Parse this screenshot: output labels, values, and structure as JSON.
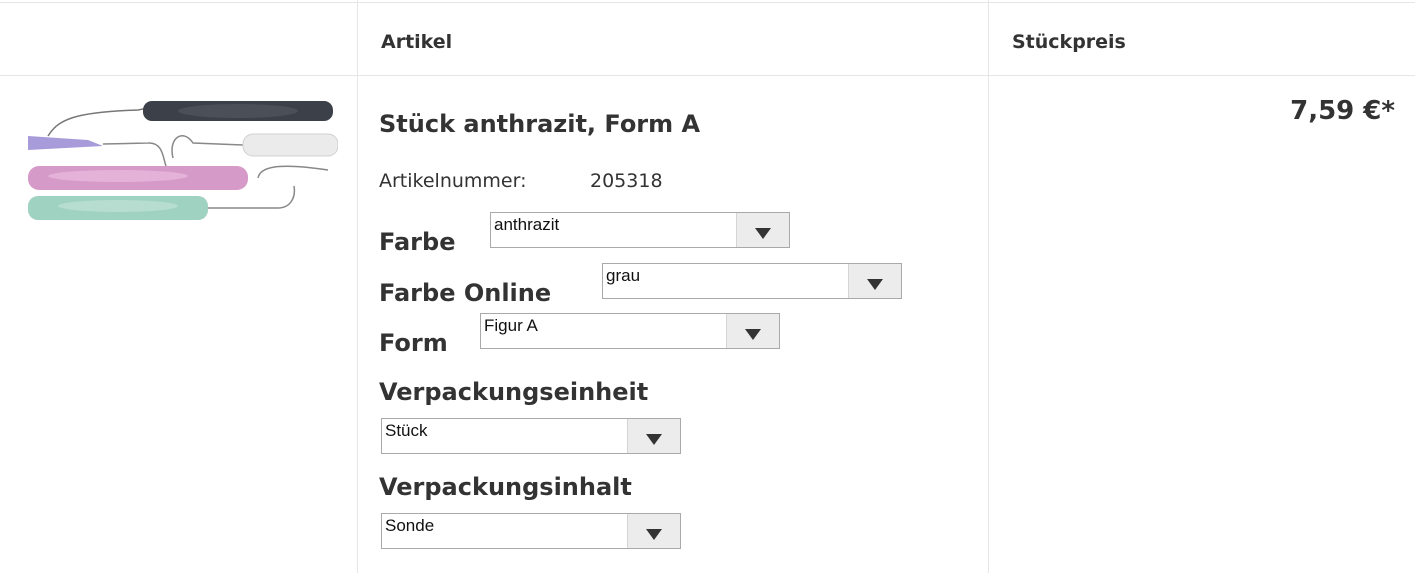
{
  "table": {
    "header_artikel": "Artikel",
    "header_stueckpreis": "Stückpreis"
  },
  "product": {
    "title": "Stück anthrazit, Form A",
    "artikelnummer_label": "Artikelnummer:",
    "artikelnummer_value": "205318",
    "price": "7,59 €*",
    "image_icon": "dental-instruments-image",
    "options": {
      "farbe": {
        "label": "Farbe",
        "selected": "anthrazit"
      },
      "farbe_online": {
        "label": "Farbe Online",
        "selected": "grau"
      },
      "form": {
        "label": "Form",
        "selected": "Figur A"
      },
      "verpackungseinheit": {
        "label": "Verpackungseinheit",
        "selected": "Stück"
      },
      "verpackungsinhalt": {
        "label": "Verpackungsinhalt",
        "selected": "Sonde"
      }
    }
  },
  "colors": {
    "border": "#e6e6e6",
    "text": "#333333"
  }
}
